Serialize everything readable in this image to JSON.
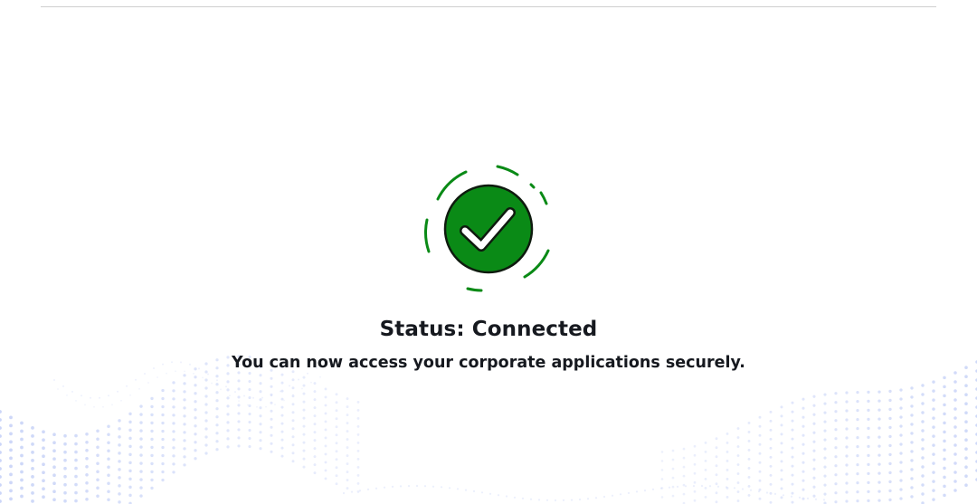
{
  "status": {
    "title": "Status: Connected",
    "message": "You can now access your corporate applications securely.",
    "icon": "check-circle-icon"
  },
  "colors": {
    "accent_green": "#0a8a16",
    "text": "#16191f",
    "dots": "#c7d2f7"
  }
}
